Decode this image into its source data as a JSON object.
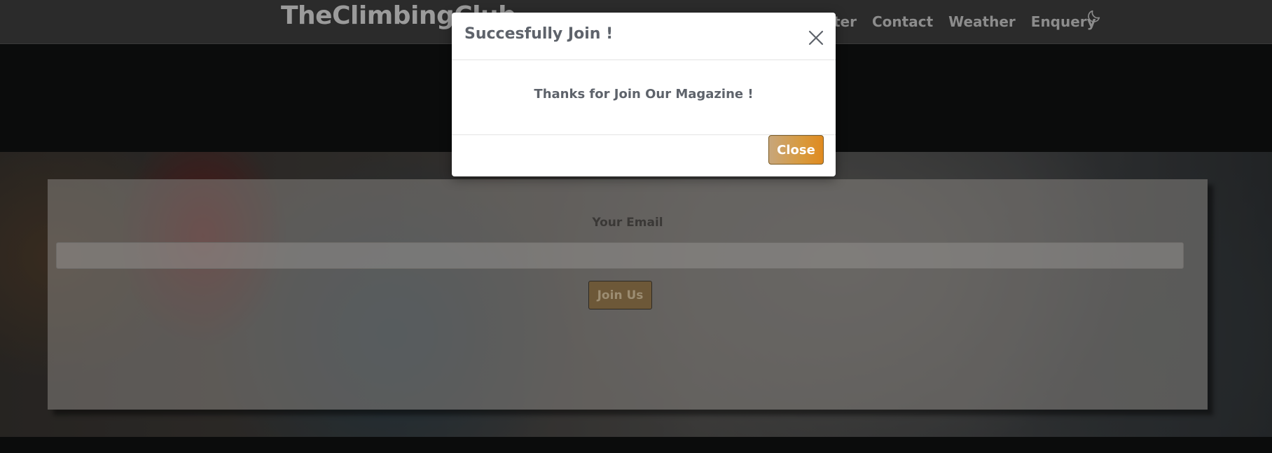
{
  "navbar": {
    "brand": "TheClimbingClub",
    "links": [
      "ter",
      "Contact",
      "Weather",
      "Enquery"
    ],
    "theme_toggle_icon": "moon-icon"
  },
  "newsletter": {
    "email_label": "Your Email",
    "email_value": "",
    "join_label": "Join Us"
  },
  "modal": {
    "title": "Succesfully Join !",
    "message": "Thanks for Join Our Magazine !",
    "close_label": "Close",
    "close_icon": "close-icon"
  },
  "colors": {
    "accent": "#d89a3e",
    "modal_text": "#5e636b"
  }
}
